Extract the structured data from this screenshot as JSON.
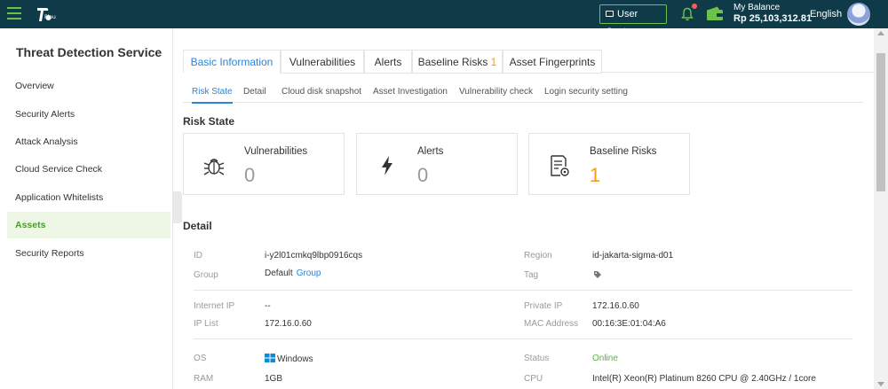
{
  "topbar": {
    "logo_text": "Plou",
    "user_center": "User Center",
    "balance_label": "My Balance",
    "balance_value": "Rp 25,103,312.81",
    "language": "English",
    "accent": "#6cc24a",
    "bg": "#0f3b48"
  },
  "sidebar": {
    "title": "Threat Detection Service",
    "items": [
      {
        "label": "Overview"
      },
      {
        "label": "Security Alerts"
      },
      {
        "label": "Attack Analysis"
      },
      {
        "label": "Cloud Service Check"
      },
      {
        "label": "Application Whitelists"
      },
      {
        "label": "Assets",
        "active": true
      },
      {
        "label": "Security Reports"
      }
    ]
  },
  "tabs": {
    "basic": "Basic Information",
    "vulns": "Vulnerabilities",
    "alerts": "Alerts",
    "baseline": "Baseline Risks",
    "baseline_count": "1",
    "fingerprints": "Asset Fingerprints"
  },
  "subtabs": {
    "risk_state": "Risk State",
    "detail": "Detail",
    "cloud_disk": "Cloud disk snapshot",
    "investigation": "Asset Investigation",
    "vuln_check": "Vulnerability check",
    "login": "Login security setting"
  },
  "risk_state": {
    "title": "Risk State",
    "cards": [
      {
        "label": "Vulnerabilities",
        "value": "0",
        "icon": "bug-icon"
      },
      {
        "label": "Alerts",
        "value": "0",
        "icon": "lightning-icon"
      },
      {
        "label": "Baseline Risks",
        "value": "1",
        "icon": "document-gear-icon"
      }
    ]
  },
  "detail": {
    "title": "Detail",
    "id_label": "ID",
    "id_value": "i-y2l01cmkq9lbp0916cqs",
    "region_label": "Region",
    "region_value": "id-jakarta-sigma-d01",
    "group_label": "Group",
    "group_value": "Default",
    "group_link": "Group",
    "tag_label": "Tag",
    "internet_ip_label": "Internet IP",
    "internet_ip_value": "--",
    "private_ip_label": "Private IP",
    "private_ip_value": "172.16.0.60",
    "ip_list_label": "IP List",
    "ip_list_value": "172.16.0.60",
    "mac_label": "MAC Address",
    "mac_value": "00:16:3E:01:04:A6",
    "os_label": "OS",
    "os_value": "Windows",
    "status_label": "Status",
    "status_value": "Online",
    "ram_label": "RAM",
    "ram_value": "1GB",
    "cpu_label": "CPU",
    "cpu_value": "Intel(R) Xeon(R) Platinum 8260 CPU @ 2.40GHz / 1core"
  }
}
